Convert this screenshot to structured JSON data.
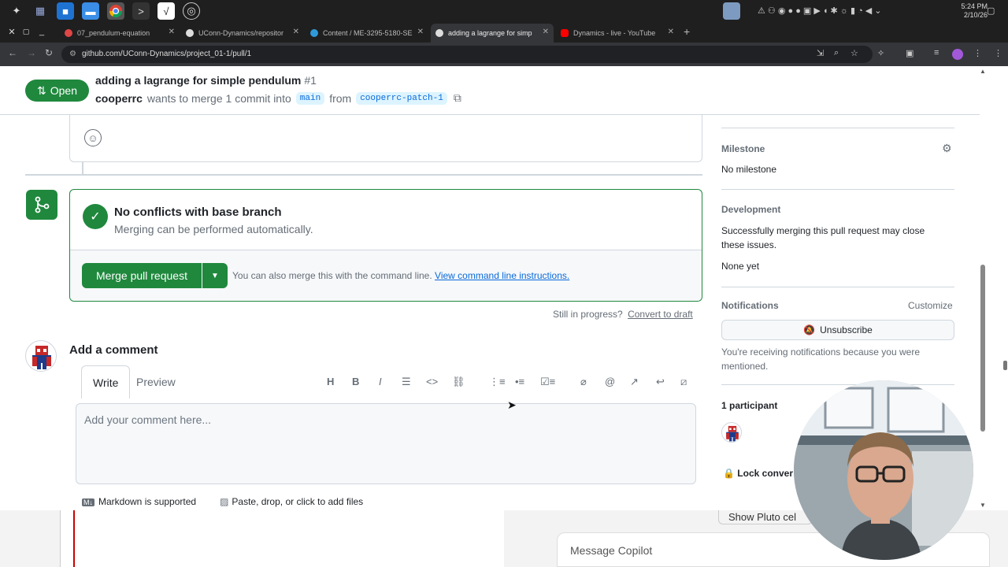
{
  "browser": {
    "tabs": [
      {
        "title": "07_pendulum-equation",
        "color": "#e04646"
      },
      {
        "title": "UConn-Dynamics/repositor",
        "color": "#dddddd"
      },
      {
        "title": "Content / ME-3295-5180-SE",
        "color": "#2f9ad8"
      },
      {
        "title": "adding a lagrange for simp",
        "color": "#dddddd"
      },
      {
        "title": "Dynamics - live - YouTube",
        "color": "#ff0000"
      }
    ],
    "url": "github.com/UConn-Dynamics/project_01-1/pull/1",
    "clock_time": "5:24 PM",
    "clock_date": "2/10/26"
  },
  "pr": {
    "state_label": "Open",
    "title": "adding a lagrange for simple pendulum",
    "number": "#1",
    "author": "cooperrc",
    "merge_text": "wants to merge 1 commit into",
    "base_branch": "main",
    "from_text": "from",
    "head_branch": "cooperrc-patch-1"
  },
  "merge": {
    "title": "No conflicts with base branch",
    "subtitle": "Merging can be performed automatically.",
    "button_label": "Merge pull request",
    "note": "You can also merge this with the command line.",
    "note_link": "View command line instructions.",
    "still_text": "Still in progress?",
    "draft_link": "Convert to draft"
  },
  "comment": {
    "heading": "Add a comment",
    "tab_write": "Write",
    "tab_preview": "Preview",
    "placeholder": "Add your comment here...",
    "markdown_note": "Markdown is supported",
    "files_note": "Paste, drop, or click to add files"
  },
  "sidebar": {
    "milestone_heading": "Milestone",
    "milestone_value": "No milestone",
    "development_heading": "Development",
    "development_text": "Successfully merging this pull request may close these issues.",
    "development_value": "None yet",
    "notifications_heading": "Notifications",
    "customize_label": "Customize",
    "unsubscribe_label": "Unsubscribe",
    "notifications_text": "You're receiving notifications because you were mentioned.",
    "participants_heading": "1 participant",
    "lock_label": "Lock conver"
  },
  "bottom": {
    "pluto_label": "Show Pluto cel",
    "copilot_placeholder": "Message Copilot"
  },
  "colors": {
    "accent_green": "#1f883d",
    "link_blue": "#0969da"
  }
}
